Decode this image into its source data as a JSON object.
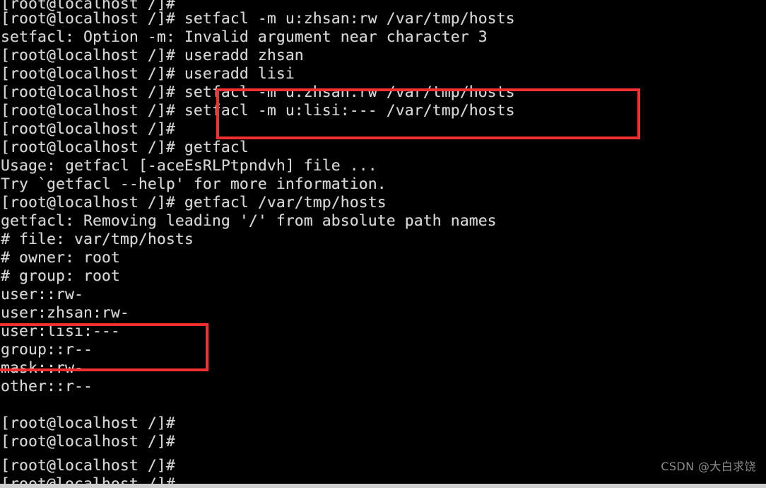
{
  "terminal": {
    "shell_prompt": "[root@localhost /]#",
    "background_color": "#000000",
    "text_color": "#d4d4d4",
    "highlight_color": "#f23030",
    "lines": [
      {
        "text": "[root@localhost /]#",
        "kind": "prompt-clipped"
      },
      {
        "text": "[root@localhost /]# setfacl -m u:zhsan:rw /var/tmp/hosts",
        "kind": "prompt-command"
      },
      {
        "text": "setfacl: Option -m: Invalid argument near character 3",
        "kind": "output-error"
      },
      {
        "text": "[root@localhost /]# useradd zhsan",
        "kind": "prompt-command"
      },
      {
        "text": "[root@localhost /]# useradd lisi",
        "kind": "prompt-command"
      },
      {
        "text": "[root@localhost /]# setfacl -m u:zhsan:rw /var/tmp/hosts",
        "kind": "prompt-command"
      },
      {
        "text": "[root@localhost /]# setfacl -m u:lisi:--- /var/tmp/hosts",
        "kind": "prompt-command"
      },
      {
        "text": "[root@localhost /]#",
        "kind": "prompt"
      },
      {
        "text": "[root@localhost /]# getfacl",
        "kind": "prompt-command"
      },
      {
        "text": "Usage: getfacl [-aceEsRLPtpndvh] file ...",
        "kind": "output"
      },
      {
        "text": "Try `getfacl --help' for more information.",
        "kind": "output"
      },
      {
        "text": "[root@localhost /]# getfacl /var/tmp/hosts",
        "kind": "prompt-command"
      },
      {
        "text": "getfacl: Removing leading '/' from absolute path names",
        "kind": "output"
      },
      {
        "text": "# file: var/tmp/hosts",
        "kind": "output"
      },
      {
        "text": "# owner: root",
        "kind": "output"
      },
      {
        "text": "# group: root",
        "kind": "output"
      },
      {
        "text": "user::rw-",
        "kind": "output"
      },
      {
        "text": "user:zhsan:rw-",
        "kind": "output"
      },
      {
        "text": "user:lisi:---",
        "kind": "output"
      },
      {
        "text": "group::r--",
        "kind": "output"
      },
      {
        "text": "mask::rw-",
        "kind": "output"
      },
      {
        "text": "other::r--",
        "kind": "output"
      },
      {
        "text": "",
        "kind": "blank"
      },
      {
        "text": "[root@localhost /]#",
        "kind": "prompt"
      },
      {
        "text": "[root@localhost /]#",
        "kind": "prompt"
      }
    ]
  },
  "annotations": {
    "boxes": [
      {
        "id": "setfacl-commands",
        "label": "setfacl commands highlight"
      },
      {
        "id": "acl-user-entries",
        "label": "acl user entries highlight"
      }
    ]
  },
  "watermark": {
    "text": "CSDN @大白求饶"
  }
}
